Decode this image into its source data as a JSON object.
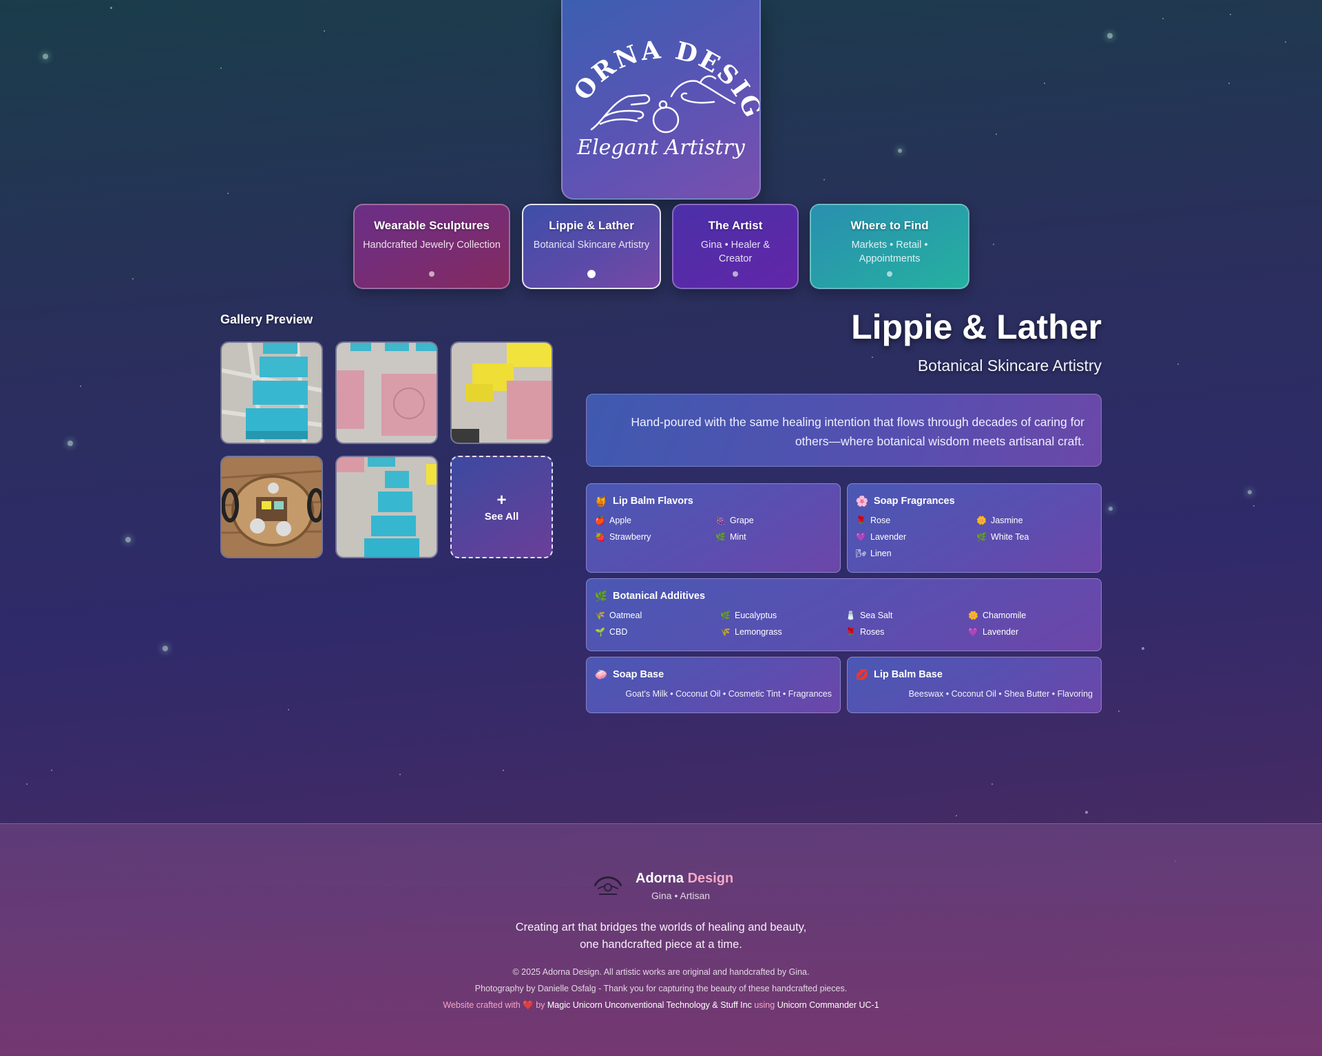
{
  "logo": {
    "brand": "ADORNA DESIGN",
    "tagline": "Elegant Artistry"
  },
  "nav": [
    {
      "title": "Wearable Sculptures",
      "subtitle": "Handcrafted Jewelry Collection"
    },
    {
      "title": "Lippie & Lather",
      "subtitle": "Botanical Skincare Artistry"
    },
    {
      "title": "The Artist",
      "subtitle": "Gina • Healer & Creator"
    },
    {
      "title": "Where to Find",
      "subtitle": "Markets • Retail • Appointments"
    }
  ],
  "gallery": {
    "title": "Gallery Preview",
    "plus": "+",
    "see_all": "See All"
  },
  "main": {
    "title": "Lippie & Lather",
    "subtitle": "Botanical Skincare Artistry",
    "description": "Hand-poured with the same healing intention that flows through decades of caring for others—where botanical wisdom meets artisanal craft."
  },
  "lip_balm": {
    "title": "Lip Balm Flavors",
    "icon": "honey-pot-icon",
    "items": [
      {
        "label": "Apple",
        "icon": "apple-icon"
      },
      {
        "label": "Grape",
        "icon": "grape-icon"
      },
      {
        "label": "Strawberry",
        "icon": "strawberry-icon"
      },
      {
        "label": "Mint",
        "icon": "herb-icon"
      }
    ]
  },
  "soap_fragrances": {
    "title": "Soap Fragrances",
    "icon": "cherry-blossom-icon",
    "items": [
      {
        "label": "Rose",
        "icon": "rose-icon"
      },
      {
        "label": "Jasmine",
        "icon": "sunflower-icon"
      },
      {
        "label": "Lavender",
        "icon": "purple-heart-icon"
      },
      {
        "label": "White Tea",
        "icon": "herb-icon"
      },
      {
        "label": "Linen",
        "icon": "wind-icon"
      }
    ]
  },
  "botanical": {
    "title": "Botanical Additives",
    "icon": "herb-icon",
    "items": [
      {
        "label": "Oatmeal",
        "icon": "grain-icon"
      },
      {
        "label": "Eucalyptus",
        "icon": "herb-icon"
      },
      {
        "label": "Sea Salt",
        "icon": "salt-icon"
      },
      {
        "label": "Chamomile",
        "icon": "sunflower-icon"
      },
      {
        "label": "CBD",
        "icon": "seedling-icon"
      },
      {
        "label": "Lemongrass",
        "icon": "grain-icon"
      },
      {
        "label": "Roses",
        "icon": "rose-icon"
      },
      {
        "label": "Lavender",
        "icon": "purple-heart-icon"
      }
    ]
  },
  "soap_base": {
    "title": "Soap Base",
    "icon": "soap-icon",
    "text": "Goat's Milk • Coconut Oil • Cosmetic Tint • Fragrances"
  },
  "lip_base": {
    "title": "Lip Balm Base",
    "icon": "lips-icon",
    "text": "Beeswax • Coconut Oil • Shea Butter • Flavoring"
  },
  "footer": {
    "name_a": "Adorna",
    "name_b": "Design",
    "sub": "Gina • Artisan",
    "tag1": "Creating art that bridges the worlds of healing and beauty,",
    "tag2": "one handcrafted piece at a time.",
    "copyright": "© 2025 Adorna Design. All artistic works are original and handcrafted by Gina.",
    "photo": "Photography by Danielle Osfalg - Thank you for capturing the beauty of these handcrafted pieces.",
    "crafted_a": "Website crafted with",
    "crafted_by": "by",
    "crafted_company": "Magic Unicorn Unconventional Technology & Stuff Inc",
    "crafted_using": "using",
    "crafted_tool": "Unicorn Commander UC-1"
  },
  "colors": {
    "nav_wearable": "#7a2a6e",
    "nav_lippie": "#4a4ea8",
    "nav_artist": "#5a2aa8",
    "nav_where": "#26a8a8",
    "accent_pink": "#f2a6c6"
  }
}
